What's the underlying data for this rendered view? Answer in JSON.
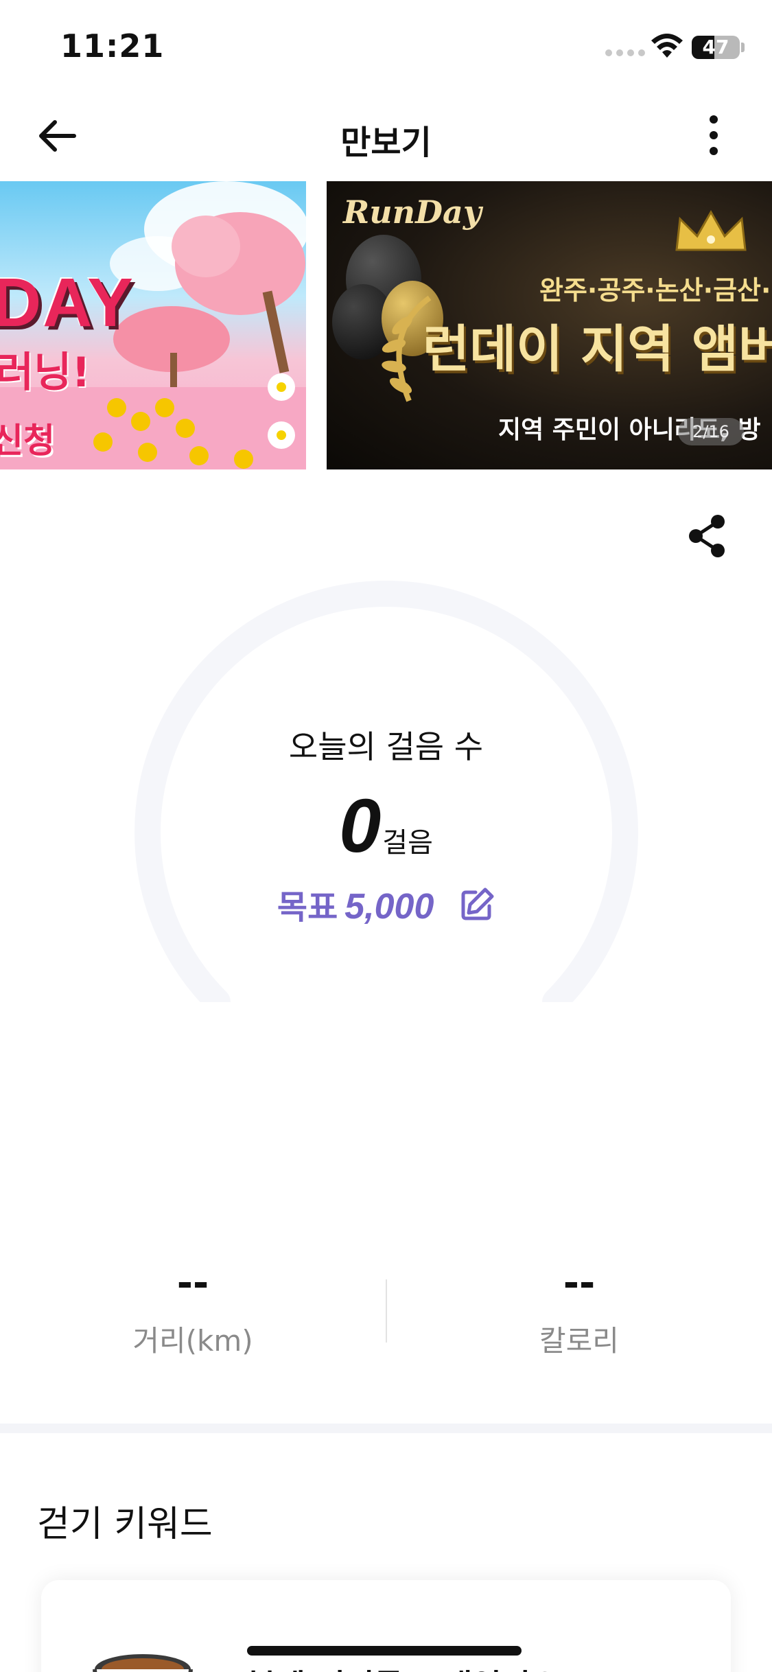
{
  "status_bar": {
    "time": "11:21",
    "battery": "47",
    "battery_level": 0.47
  },
  "header": {
    "title": "만보기"
  },
  "banners": {
    "left": {
      "line1": "DAY",
      "line2": "러닝!",
      "line3": "신청"
    },
    "right": {
      "logo": "RunDay",
      "subtitle": "완주·공주·논산·금산·",
      "title": "런데이 지역 앰버",
      "caption": "지역 주민이 아니라도, 방",
      "counter": "2/16"
    }
  },
  "pedometer": {
    "label": "오늘의 걸음 수",
    "steps": "0",
    "steps_unit": "걸음",
    "goal_label": "목표",
    "goal_value": "5,000",
    "progress": 0
  },
  "stats": {
    "distance": {
      "value": "--",
      "label": "거리(km)"
    },
    "calories": {
      "value": "--",
      "label": "칼로리"
    }
  },
  "keywords": {
    "title": "걷기 키워드",
    "card_text": "봄에 피어를 보내었어요"
  },
  "colors": {
    "accent": "#7565c8",
    "gauge_track": "#f5f6fa"
  },
  "icons": {
    "back": "arrow-left-icon",
    "more": "more-vertical-icon",
    "share": "share-icon",
    "edit": "edit-icon",
    "wifi": "wifi-icon",
    "cup": "coffee-cup-icon"
  }
}
